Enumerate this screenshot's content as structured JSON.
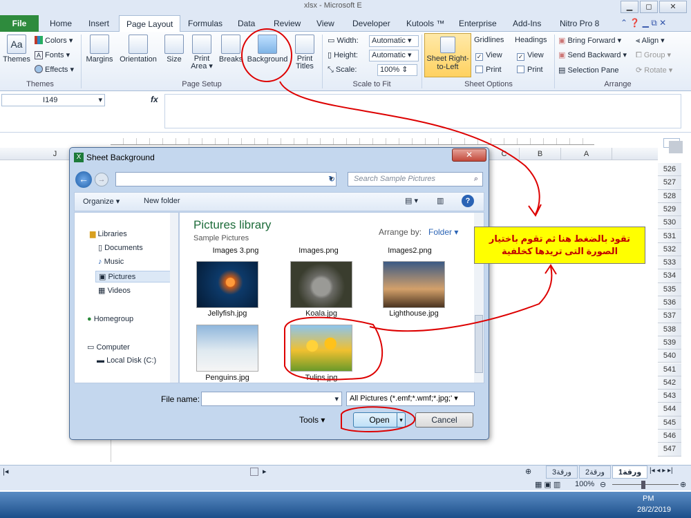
{
  "window": {
    "title": "xlsx - Microsoft E",
    "min": "▭",
    "restore": "⧉",
    "close": "✕"
  },
  "tabs": [
    "File",
    "Home",
    "Insert",
    "Page Layout",
    "Formulas",
    "Data",
    "Review",
    "View",
    "Developer",
    "Kutools ™",
    "Enterprise",
    "Add-Ins",
    "Nitro Pro 8"
  ],
  "active_tab": "Page Layout",
  "ribbon": {
    "themes": {
      "themes": "Themes",
      "colors": "Colors ▾",
      "fonts": "Fonts ▾",
      "effects": "Effects ▾",
      "group": "Themes"
    },
    "page_setup": {
      "margins": "Margins",
      "orientation": "Orientation",
      "size": "Size",
      "print_area": "Print Area ▾",
      "breaks": "Breaks",
      "background": "Background",
      "print_titles": "Print Titles",
      "group": "Page Setup"
    },
    "scale": {
      "width_label": "Width:",
      "width_val": "Automatic",
      "height_label": "Height:",
      "height_val": "Automatic",
      "scale_label": "Scale:",
      "scale_val": "100%",
      "group": "Scale to Fit"
    },
    "sheet_options": {
      "sheet_rtl": "Sheet Right-to-Left",
      "gridlines": "Gridlines",
      "headings": "Headings",
      "view1": "View",
      "print1": "Print",
      "view2": "View",
      "print2": "Print",
      "group": "Sheet Options"
    },
    "arrange": {
      "bring_forward": "Bring Forward ▾",
      "send_backward": "Send Backward ▾",
      "selection_pane": "Selection Pane",
      "align": "Align ▾",
      "group_btn": "Group ▾",
      "rotate": "Rotate ▾",
      "group": "Arrange"
    }
  },
  "namebox": "I149",
  "fx": "fx",
  "columns": [
    "J",
    "C",
    "B",
    "A"
  ],
  "rows": [
    "526",
    "527",
    "528",
    "529",
    "530",
    "531",
    "532",
    "533",
    "534",
    "535",
    "536",
    "537",
    "538",
    "539",
    "540",
    "541",
    "542",
    "543",
    "544",
    "545",
    "546",
    "547"
  ],
  "dialog": {
    "title": "Sheet Background",
    "close": "✕",
    "search_placeholder": "Search Sample Pictures",
    "organize": "Organize ▾",
    "new_folder": "New folder",
    "library_title": "Pictures library",
    "library_sub": "Sample Pictures",
    "arrange_by": "Arrange by:",
    "arrange_val": "Folder ▾",
    "nav": [
      "Libraries",
      "Documents",
      "Music",
      "Pictures",
      "Videos",
      "Homegroup",
      "Computer",
      "Local Disk (C:)"
    ],
    "top_row": [
      "Images 3.png",
      "Images.png",
      "Images2.png"
    ],
    "files": [
      "Jellyfish.jpg",
      "Koala.jpg",
      "Lighthouse.jpg",
      "Penguins.jpg",
      "Tulips.jpg"
    ],
    "file_name_label": "File name:",
    "file_type": "All Pictures (*.emf;*.wmf;*.jpg;' ▾",
    "tools": "Tools",
    "open": "Open",
    "cancel": "Cancel"
  },
  "annotation": "تقود بالضغط هنا ثم تقوم باختيار الصورة التى تريدها كخلفية",
  "sheet_tabs": [
    "ورقة1",
    "ورقة2",
    "ورقة3"
  ],
  "zoom": "100%",
  "clock": {
    "time": "PM",
    "date": "28/2/2019"
  }
}
